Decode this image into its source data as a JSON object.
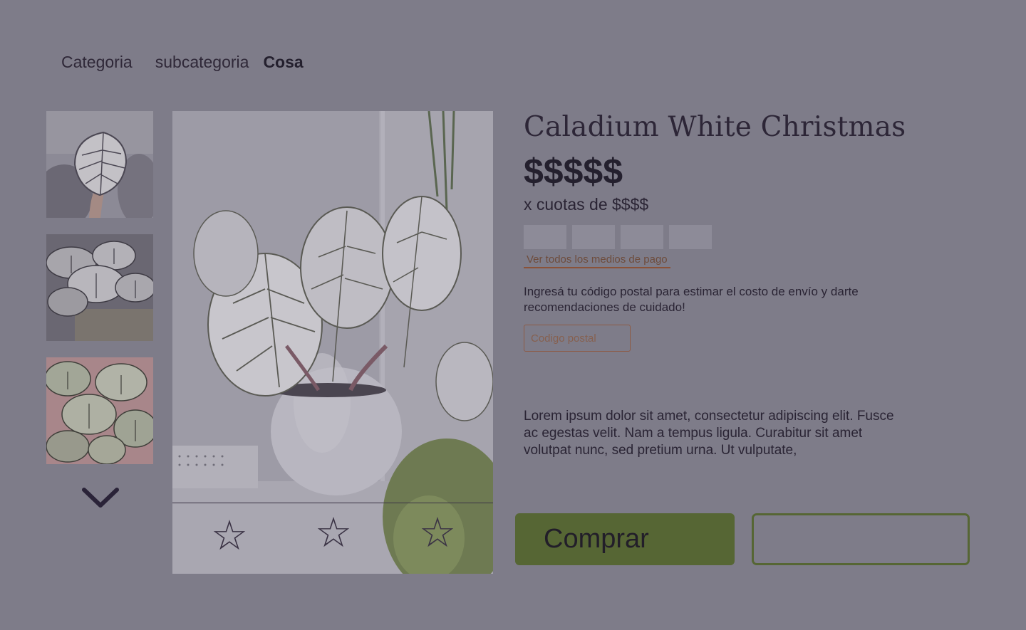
{
  "breadcrumb": {
    "category": "Categoria",
    "subcategory": "subcategoria",
    "current": "Cosa"
  },
  "product": {
    "title": "Caladium White Christmas",
    "price": "$$$$$",
    "installments": "x cuotas de $$$$",
    "payment_link": "Ver todos los medios de pago",
    "postal_prompt": "Ingresá tu código postal para estimar el costo de envío y darte recomendaciones de cuidado!",
    "postal_placeholder": "Codigo postal",
    "description": "Lorem ipsum dolor sit amet, consectetur adipiscing elit. Fusce ac egestas velit. Nam a tempus ligula. Curabitur sit amet volutpat nunc, sed pretium urna. Ut vulputate,"
  },
  "gallery": {
    "scroll_icon": "chevron-down-icon"
  },
  "rating": {
    "stars": [
      "☆",
      "☆",
      "☆"
    ],
    "icon": "star-icon"
  },
  "actions": {
    "buy_label": "Comprar",
    "secondary_label": ""
  },
  "colors": {
    "overlay_bg": "#7e7c89",
    "accent_green": "#566634",
    "link_brown": "#8a5238",
    "text_dark": "#24202e"
  }
}
